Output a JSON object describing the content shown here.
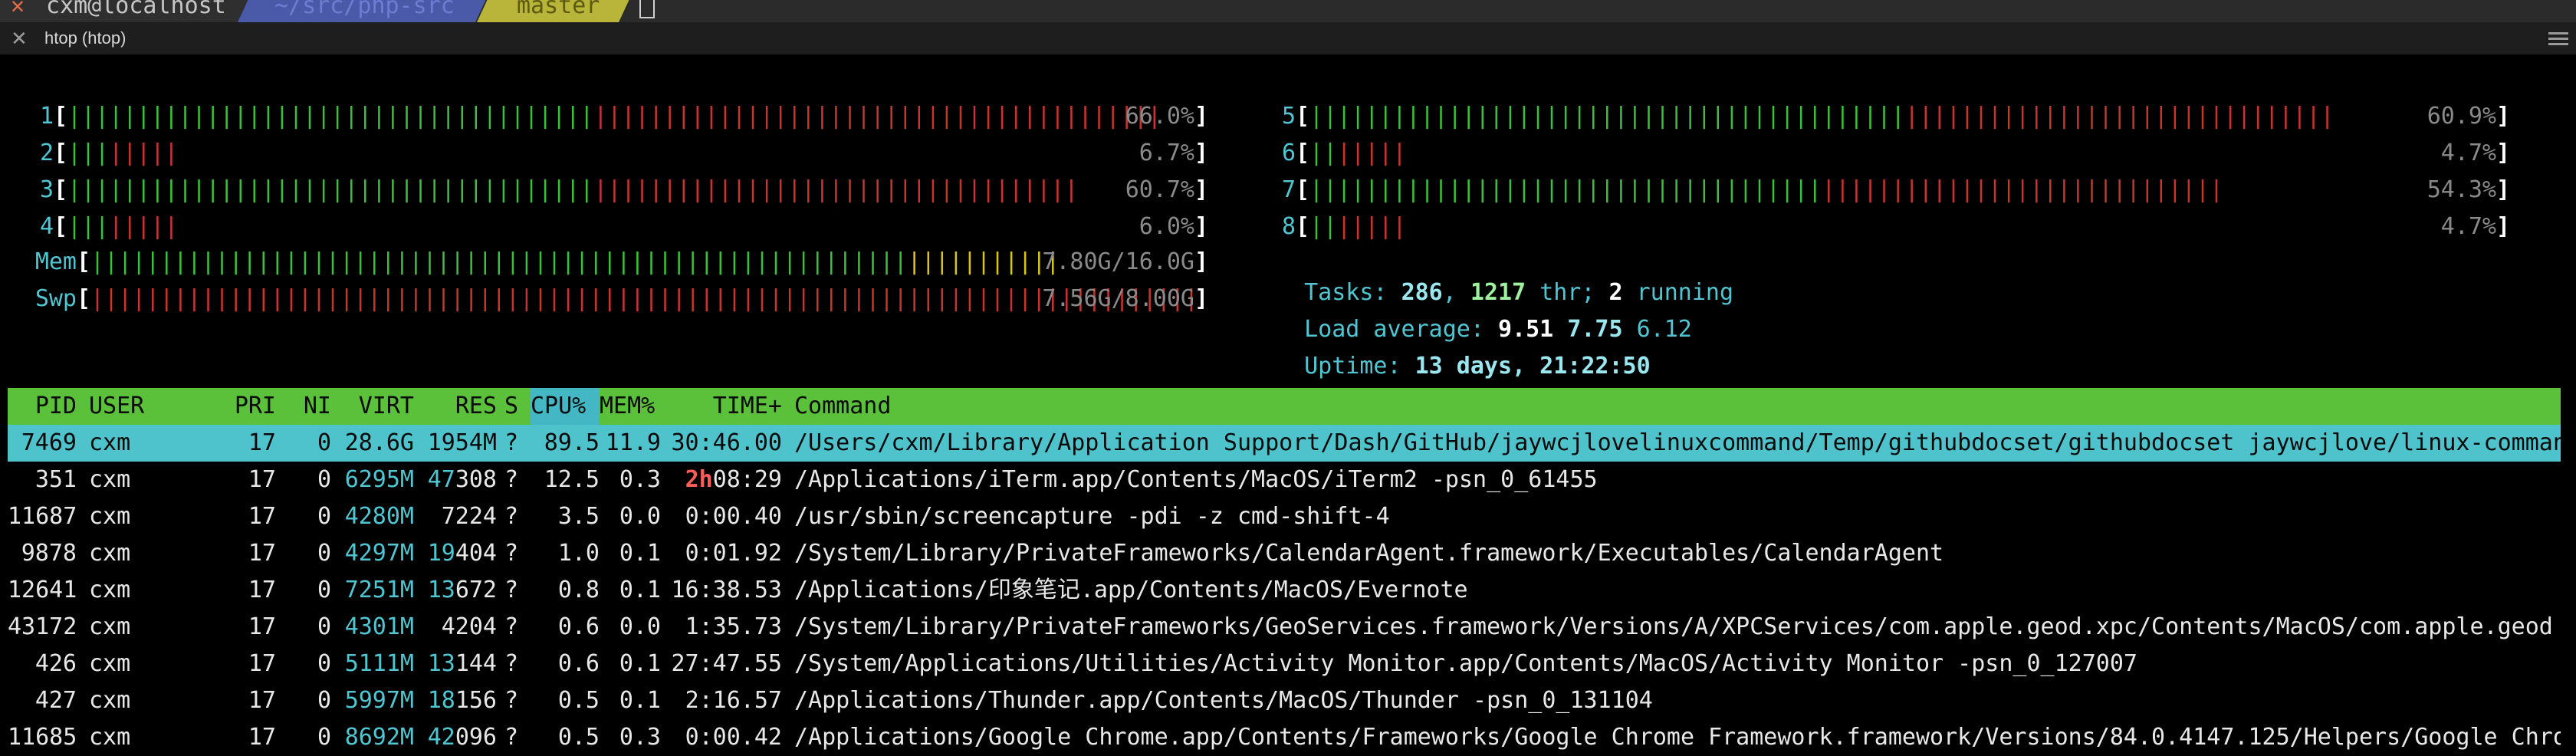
{
  "topbar": {
    "user_host": "cxm@localhost",
    "path": "~/src/php-src",
    "branch": "master"
  },
  "window": {
    "title": "htop (htop)"
  },
  "cpu_meters": [
    {
      "label": "1",
      "value": "66.0%",
      "green": 38,
      "red": 41
    },
    {
      "label": "2",
      "value": "6.7%",
      "green": 3,
      "red": 5
    },
    {
      "label": "3",
      "value": "60.7%",
      "green": 38,
      "red": 35
    },
    {
      "label": "4",
      "value": "6.0%",
      "green": 3,
      "red": 5
    },
    {
      "label": "5",
      "value": "60.9%",
      "green": 43,
      "red": 31
    },
    {
      "label": "6",
      "value": "4.7%",
      "green": 2,
      "red": 5
    },
    {
      "label": "7",
      "value": "54.3%",
      "green": 37,
      "red": 29
    },
    {
      "label": "8",
      "value": "4.7%",
      "green": 2,
      "red": 5
    }
  ],
  "mem": {
    "label": "Mem",
    "value": "7.80G/16.0G",
    "green": 59,
    "yellow": 11
  },
  "swp": {
    "label": "Swp",
    "value": "7.56G/8.00G",
    "red": 102
  },
  "tasks": {
    "label": "Tasks:",
    "count": "286",
    "sep": ",",
    "threads": "1217",
    "thr_label": "thr;",
    "running": "2",
    "running_label": "running"
  },
  "load": {
    "label": "Load average:",
    "l1": "9.51",
    "l5": "7.75",
    "l15": "6.12"
  },
  "uptime": {
    "label": "Uptime:",
    "value": "13 days, 21:22:50"
  },
  "columns": {
    "pid": "PID",
    "user": "USER",
    "pri": "PRI",
    "ni": "NI",
    "virt": "VIRT",
    "res": "RES",
    "s": "S",
    "cpu": "CPU%",
    "mem": "MEM%",
    "time": "TIME+",
    "command": "Command"
  },
  "processes": [
    {
      "pid": "7469",
      "user": "cxm",
      "pri": "17",
      "ni": "0",
      "virt": "28.6G",
      "res_a": "1954M",
      "res_b": "",
      "s": "?",
      "cpu": "89.5",
      "mem": "11.9",
      "time_h": "",
      "time": "30:46.00",
      "command": "/Users/cxm/Library/Application Support/Dash/GitHub/jaywcjlovelinuxcommand/Temp/githubdocset/githubdocset jaywcjlove/linux-comman"
    },
    {
      "pid": "351",
      "user": "cxm",
      "pri": "17",
      "ni": "0",
      "virt": "6295M",
      "res_a": "47",
      "res_b": "308",
      "s": "?",
      "cpu": "12.5",
      "mem": "0.3",
      "time_h": "2h",
      "time": "08:29",
      "command": "/Applications/iTerm.app/Contents/MacOS/iTerm2 -psn_0_61455"
    },
    {
      "pid": "11687",
      "user": "cxm",
      "pri": "17",
      "ni": "0",
      "virt": "4280M",
      "res_a": "",
      "res_b": "7224",
      "s": "?",
      "cpu": "3.5",
      "mem": "0.0",
      "time_h": "",
      "time": "0:00.40",
      "command": "/usr/sbin/screencapture -pdi -z cmd-shift-4"
    },
    {
      "pid": "9878",
      "user": "cxm",
      "pri": "17",
      "ni": "0",
      "virt": "4297M",
      "res_a": "19",
      "res_b": "404",
      "s": "?",
      "cpu": "1.0",
      "mem": "0.1",
      "time_h": "",
      "time": "0:01.92",
      "command": "/System/Library/PrivateFrameworks/CalendarAgent.framework/Executables/CalendarAgent"
    },
    {
      "pid": "12641",
      "user": "cxm",
      "pri": "17",
      "ni": "0",
      "virt": "7251M",
      "res_a": "13",
      "res_b": "672",
      "s": "?",
      "cpu": "0.8",
      "mem": "0.1",
      "time_h": "",
      "time": "16:38.53",
      "command": "/Applications/印象笔记.app/Contents/MacOS/Evernote"
    },
    {
      "pid": "43172",
      "user": "cxm",
      "pri": "17",
      "ni": "0",
      "virt": "4301M",
      "res_a": "",
      "res_b": "4204",
      "s": "?",
      "cpu": "0.6",
      "mem": "0.0",
      "time_h": "",
      "time": "1:35.73",
      "command": "/System/Library/PrivateFrameworks/GeoServices.framework/Versions/A/XPCServices/com.apple.geod.xpc/Contents/MacOS/com.apple.geod"
    },
    {
      "pid": "426",
      "user": "cxm",
      "pri": "17",
      "ni": "0",
      "virt": "5111M",
      "res_a": "13",
      "res_b": "144",
      "s": "?",
      "cpu": "0.6",
      "mem": "0.1",
      "time_h": "",
      "time": "27:47.55",
      "command": "/System/Applications/Utilities/Activity Monitor.app/Contents/MacOS/Activity Monitor -psn_0_127007"
    },
    {
      "pid": "427",
      "user": "cxm",
      "pri": "17",
      "ni": "0",
      "virt": "5997M",
      "res_a": "18",
      "res_b": "156",
      "s": "?",
      "cpu": "0.5",
      "mem": "0.1",
      "time_h": "",
      "time": "2:16.57",
      "command": "/Applications/Thunder.app/Contents/MacOS/Thunder -psn_0_131104"
    },
    {
      "pid": "11685",
      "user": "cxm",
      "pri": "17",
      "ni": "0",
      "virt": "8692M",
      "res_a": "42",
      "res_b": "096",
      "s": "?",
      "cpu": "0.5",
      "mem": "0.3",
      "time_h": "",
      "time": "0:00.42",
      "command": "/Applications/Google Chrome.app/Contents/Frameworks/Google Chrome Framework.framework/Versions/84.0.4147.125/Helpers/Google Chro"
    }
  ],
  "colors": {
    "bar_green": "#3cbf3c",
    "bar_red": "#c8342f",
    "bar_yellow": "#d8c51a",
    "label_cyan": "#4fc6d2",
    "header_green": "#5bc03a",
    "selected_row": "#4fc3cc"
  }
}
